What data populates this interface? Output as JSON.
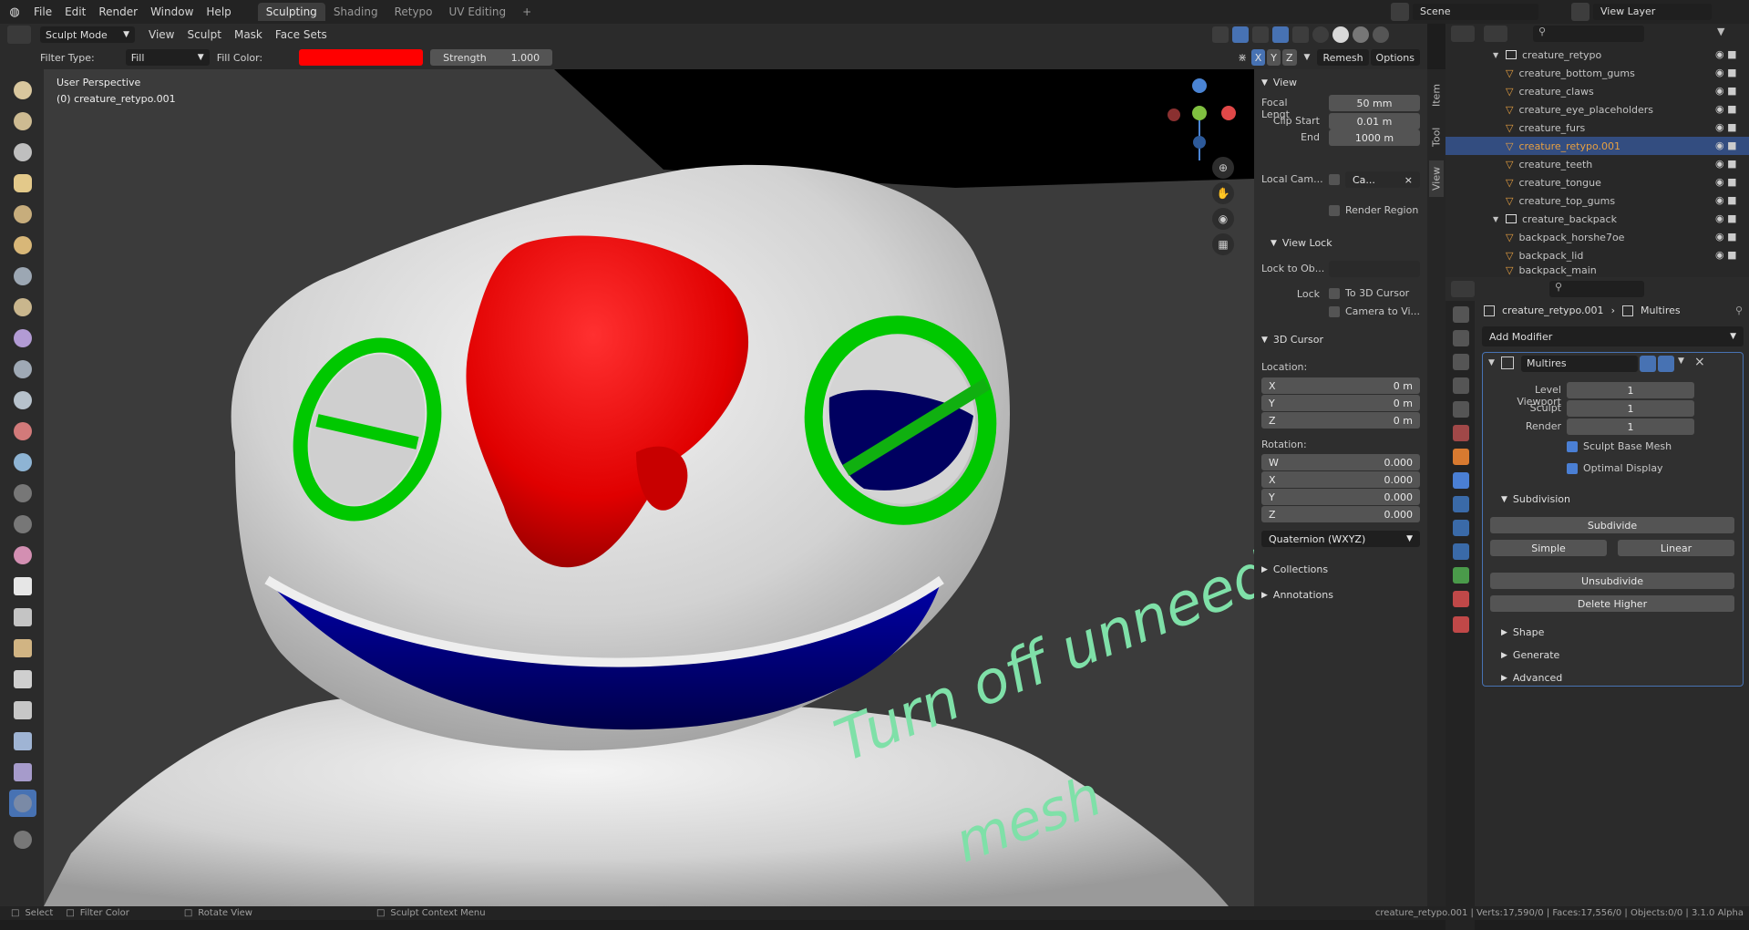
{
  "topbar": {
    "menus": [
      "File",
      "Edit",
      "Render",
      "Window",
      "Help"
    ],
    "workspaces": [
      "Sculpting",
      "Shading",
      "Retypo",
      "UV Editing"
    ],
    "active_workspace": "Sculpting",
    "add_workspace": "+",
    "scene_label": "Scene",
    "view_layer_label": "View Layer"
  },
  "toolheader": {
    "mode": "Sculpt Mode",
    "menus": [
      "View",
      "Sculpt",
      "Mask",
      "Face Sets"
    ],
    "axes": [
      "X",
      "Y",
      "Z"
    ],
    "remesh": "Remesh",
    "options": "Options"
  },
  "filterbar": {
    "filter_type_label": "Filter Type:",
    "filter_type_value": "Fill",
    "fill_color_label": "Fill Color:",
    "fill_color": "#ff0000",
    "strength_label": "Strength",
    "strength_value": "1.000"
  },
  "viewport": {
    "perspective": "User Perspective",
    "object": "(0) creature_retypo.001",
    "annotation_line1": "Turn off unneeded",
    "annotation_line2": "mesh"
  },
  "npanel": {
    "view_header": "View",
    "focal_label": "Focal Lengt",
    "focal_value": "50 mm",
    "clip_start_label": "Clip Start",
    "clip_start_value": "0.01 m",
    "end_label": "End",
    "end_value": "1000 m",
    "local_cam_label": "Local Cam...",
    "local_cam_value": "Ca...",
    "render_region": "Render Region",
    "view_lock_header": "View Lock",
    "lock_to_obj_label": "Lock to Ob...",
    "lock_label": "Lock",
    "to_3d_cursor": "To 3D Cursor",
    "camera_to_view": "Camera to Vi...",
    "cursor_header": "3D Cursor",
    "location_label": "Location:",
    "loc": [
      {
        "axis": "X",
        "value": "0 m"
      },
      {
        "axis": "Y",
        "value": "0 m"
      },
      {
        "axis": "Z",
        "value": "0 m"
      }
    ],
    "rotation_label": "Rotation:",
    "rot": [
      {
        "axis": "W",
        "value": "0.000"
      },
      {
        "axis": "X",
        "value": "0.000"
      },
      {
        "axis": "Y",
        "value": "0.000"
      },
      {
        "axis": "Z",
        "value": "0.000"
      }
    ],
    "rotation_mode": "Quaternion (WXYZ)",
    "collections": "Collections",
    "annotations": "Annotations"
  },
  "vtabs": [
    "Item",
    "Tool",
    "View"
  ],
  "outliner": {
    "rows": [
      {
        "label": "creature_retypo",
        "type": "collection"
      },
      {
        "label": "creature_bottom_gums",
        "type": "object"
      },
      {
        "label": "creature_claws",
        "type": "object"
      },
      {
        "label": "creature_eye_placeholders",
        "type": "object"
      },
      {
        "label": "creature_furs",
        "type": "object"
      },
      {
        "label": "creature_retypo.001",
        "type": "object",
        "selected": true
      },
      {
        "label": "creature_teeth",
        "type": "object"
      },
      {
        "label": "creature_tongue",
        "type": "object"
      },
      {
        "label": "creature_top_gums",
        "type": "object"
      },
      {
        "label": "creature_backpack",
        "type": "collection"
      },
      {
        "label": "backpack_horshe7oe",
        "type": "object"
      },
      {
        "label": "backpack_lid",
        "type": "object"
      },
      {
        "label": "backpack_main",
        "type": "object"
      }
    ]
  },
  "properties": {
    "object_name": "creature_retypo.001",
    "modifier_breadcrumb": "Multires",
    "add_modifier": "Add Modifier",
    "modifier_name": "Multires",
    "level_viewport_label": "Level Viewport",
    "level_viewport": "1",
    "sculpt_label": "Sculpt",
    "sculpt": "1",
    "render_label": "Render",
    "render": "1",
    "sculpt_base_mesh": "Sculpt Base Mesh",
    "optimal_display": "Optimal Display",
    "subdivision_header": "Subdivision",
    "subdivide": "Subdivide",
    "simple": "Simple",
    "linear": "Linear",
    "unsubdivide": "Unsubdivide",
    "delete_higher": "Delete Higher",
    "shape": "Shape",
    "generate": "Generate",
    "advanced": "Advanced"
  },
  "statusbar": {
    "select": "Select",
    "filter_color": "Filter Color",
    "rotate_view": "Rotate View",
    "context_menu": "Sculpt Context Menu",
    "stats": "creature_retypo.001 | Verts:17,590/0 | Faces:17,556/0 | Objects:0/0 | 3.1.0 Alpha"
  },
  "colors": {
    "accent": "#4772b3",
    "nose": "#ff0000",
    "eyes": "#00cc00",
    "mouth": "#0000bb",
    "annotation": "#7fe0a8"
  }
}
